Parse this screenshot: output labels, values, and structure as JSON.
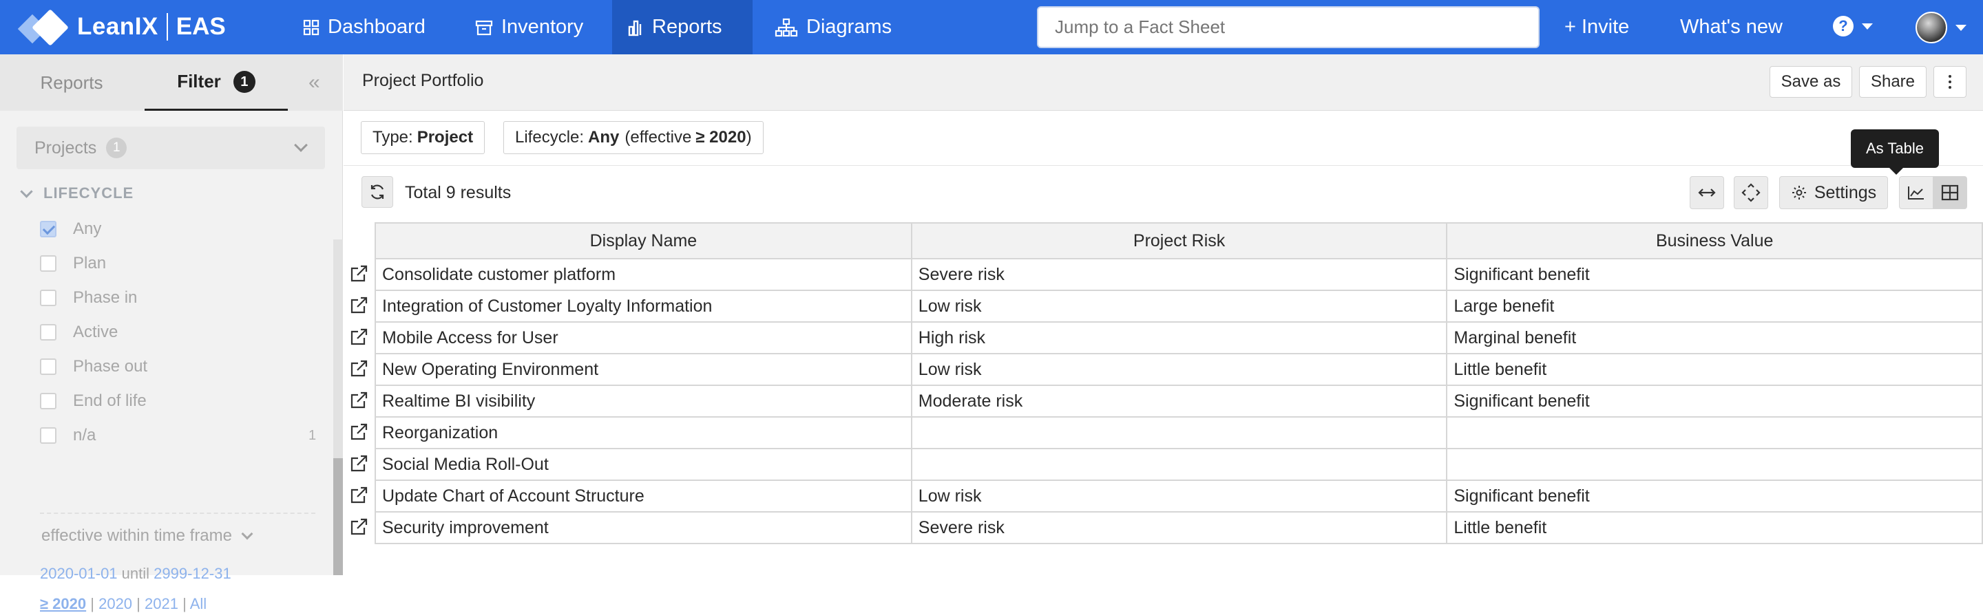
{
  "brand": {
    "name": "LeanIX",
    "product": "EAS"
  },
  "nav": {
    "items": [
      {
        "label": "Dashboard",
        "icon": "dashboard-grid-icon"
      },
      {
        "label": "Inventory",
        "icon": "inventory-box-icon"
      },
      {
        "label": "Reports",
        "icon": "bar-chart-icon",
        "active": true
      },
      {
        "label": "Diagrams",
        "icon": "sitemap-icon"
      }
    ],
    "search_placeholder": "Jump to a Fact Sheet",
    "invite_label": "+ Invite",
    "whats_new_label": "What's new",
    "help_label": "?",
    "accent_color": "#2b6de2"
  },
  "sidebar": {
    "tabs": [
      {
        "label": "Reports"
      },
      {
        "label": "Filter",
        "badge": "1",
        "active": true
      }
    ],
    "collapse_label": "«",
    "facet": {
      "label": "Projects",
      "count": "1"
    },
    "lifecycle": {
      "heading": "LIFECYCLE",
      "options": [
        {
          "label": "Any",
          "checked": true,
          "count": ""
        },
        {
          "label": "Plan",
          "checked": false,
          "count": ""
        },
        {
          "label": "Phase in",
          "checked": false,
          "count": ""
        },
        {
          "label": "Active",
          "checked": false,
          "count": ""
        },
        {
          "label": "Phase out",
          "checked": false,
          "count": ""
        },
        {
          "label": "End of life",
          "checked": false,
          "count": ""
        },
        {
          "label": "n/a",
          "checked": false,
          "count": "1"
        }
      ]
    },
    "timeframe": {
      "label": "effective within time frame",
      "from": "2020-01-01",
      "until_word": "until",
      "to": "2999-12-31",
      "presets": [
        "≥ 2020",
        "2020",
        "2021",
        "All"
      ]
    }
  },
  "main": {
    "title": "Project Portfolio",
    "buttons": {
      "save_as": "Save as",
      "share": "Share"
    },
    "chips": {
      "type_prefix": "Type:",
      "type_value": "Project",
      "lifecycle_prefix": "Lifecycle:",
      "lifecycle_value": "Any",
      "lifecycle_suffix": "(effective",
      "lifecycle_year": "≥ 2020",
      "lifecycle_close": ")"
    },
    "total_label": "Total 9 results",
    "settings_label": "Settings",
    "tooltip": "As Table",
    "table": {
      "columns": [
        "Display Name",
        "Project Risk",
        "Business Value"
      ],
      "rows": [
        [
          "Consolidate customer platform",
          "Severe risk",
          "Significant benefit"
        ],
        [
          "Integration of Customer Loyalty Information",
          "Low risk",
          "Large benefit"
        ],
        [
          "Mobile Access for User",
          "High risk",
          "Marginal benefit"
        ],
        [
          "New Operating Environment",
          "Low risk",
          "Little benefit"
        ],
        [
          "Realtime BI visibility",
          "Moderate risk",
          "Significant benefit"
        ],
        [
          "Reorganization",
          "",
          ""
        ],
        [
          "Social Media Roll-Out",
          "",
          ""
        ],
        [
          "Update Chart of Account Structure",
          "Low risk",
          "Significant benefit"
        ],
        [
          "Security improvement",
          "Severe risk",
          "Little benefit"
        ]
      ]
    }
  }
}
